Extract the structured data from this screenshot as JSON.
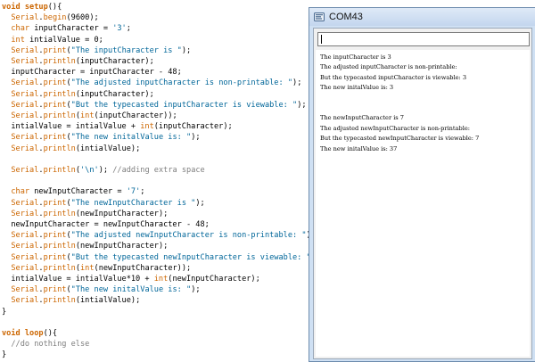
{
  "editor": {
    "lines": [
      [
        {
          "t": "void ",
          "c": "kw"
        },
        {
          "t": "setup",
          "c": "kw"
        },
        {
          "t": "(){",
          "c": ""
        }
      ],
      [
        {
          "t": "  ",
          "c": ""
        },
        {
          "t": "Serial",
          "c": "fn"
        },
        {
          "t": ".",
          "c": ""
        },
        {
          "t": "begin",
          "c": "fn"
        },
        {
          "t": "(9600);",
          "c": ""
        }
      ],
      [
        {
          "t": "  ",
          "c": ""
        },
        {
          "t": "char",
          "c": "ty"
        },
        {
          "t": " inputCharacter = ",
          "c": ""
        },
        {
          "t": "'3'",
          "c": "str"
        },
        {
          "t": ";",
          "c": ""
        }
      ],
      [
        {
          "t": "  ",
          "c": ""
        },
        {
          "t": "int",
          "c": "ty"
        },
        {
          "t": " intialValue = 0;",
          "c": ""
        }
      ],
      [
        {
          "t": "  ",
          "c": ""
        },
        {
          "t": "Serial",
          "c": "fn"
        },
        {
          "t": ".",
          "c": ""
        },
        {
          "t": "print",
          "c": "fn"
        },
        {
          "t": "(",
          "c": ""
        },
        {
          "t": "\"The inputCharacter is \"",
          "c": "str"
        },
        {
          "t": ");",
          "c": ""
        }
      ],
      [
        {
          "t": "  ",
          "c": ""
        },
        {
          "t": "Serial",
          "c": "fn"
        },
        {
          "t": ".",
          "c": ""
        },
        {
          "t": "println",
          "c": "fn"
        },
        {
          "t": "(inputCharacter);",
          "c": ""
        }
      ],
      [
        {
          "t": "  inputCharacter = inputCharacter - 48;",
          "c": ""
        }
      ],
      [
        {
          "t": "  ",
          "c": ""
        },
        {
          "t": "Serial",
          "c": "fn"
        },
        {
          "t": ".",
          "c": ""
        },
        {
          "t": "print",
          "c": "fn"
        },
        {
          "t": "(",
          "c": ""
        },
        {
          "t": "\"The adjusted inputCharacter is non-printable: \"",
          "c": "str"
        },
        {
          "t": ");",
          "c": ""
        }
      ],
      [
        {
          "t": "  ",
          "c": ""
        },
        {
          "t": "Serial",
          "c": "fn"
        },
        {
          "t": ".",
          "c": ""
        },
        {
          "t": "println",
          "c": "fn"
        },
        {
          "t": "(inputCharacter);",
          "c": ""
        }
      ],
      [
        {
          "t": "  ",
          "c": ""
        },
        {
          "t": "Serial",
          "c": "fn"
        },
        {
          "t": ".",
          "c": ""
        },
        {
          "t": "print",
          "c": "fn"
        },
        {
          "t": "(",
          "c": ""
        },
        {
          "t": "\"But the typecasted inputCharacter is viewable: \"",
          "c": "str"
        },
        {
          "t": ");",
          "c": ""
        }
      ],
      [
        {
          "t": "  ",
          "c": ""
        },
        {
          "t": "Serial",
          "c": "fn"
        },
        {
          "t": ".",
          "c": ""
        },
        {
          "t": "println",
          "c": "fn"
        },
        {
          "t": "(",
          "c": ""
        },
        {
          "t": "int",
          "c": "ty"
        },
        {
          "t": "(inputCharacter));",
          "c": ""
        }
      ],
      [
        {
          "t": "  intialValue = intialValue + ",
          "c": ""
        },
        {
          "t": "int",
          "c": "ty"
        },
        {
          "t": "(inputCharacter);",
          "c": ""
        }
      ],
      [
        {
          "t": "  ",
          "c": ""
        },
        {
          "t": "Serial",
          "c": "fn"
        },
        {
          "t": ".",
          "c": ""
        },
        {
          "t": "print",
          "c": "fn"
        },
        {
          "t": "(",
          "c": ""
        },
        {
          "t": "\"The new initalValue is: \"",
          "c": "str"
        },
        {
          "t": ");",
          "c": ""
        }
      ],
      [
        {
          "t": "  ",
          "c": ""
        },
        {
          "t": "Serial",
          "c": "fn"
        },
        {
          "t": ".",
          "c": ""
        },
        {
          "t": "println",
          "c": "fn"
        },
        {
          "t": "(intialValue);",
          "c": ""
        }
      ],
      [],
      [
        {
          "t": "  ",
          "c": ""
        },
        {
          "t": "Serial",
          "c": "fn"
        },
        {
          "t": ".",
          "c": ""
        },
        {
          "t": "println",
          "c": "fn"
        },
        {
          "t": "(",
          "c": ""
        },
        {
          "t": "'\\n'",
          "c": "str"
        },
        {
          "t": "); ",
          "c": ""
        },
        {
          "t": "//adding extra space",
          "c": "com"
        }
      ],
      [],
      [
        {
          "t": "  ",
          "c": ""
        },
        {
          "t": "char",
          "c": "ty"
        },
        {
          "t": " newInputCharacter = ",
          "c": ""
        },
        {
          "t": "'7'",
          "c": "str"
        },
        {
          "t": ";",
          "c": ""
        }
      ],
      [
        {
          "t": "  ",
          "c": ""
        },
        {
          "t": "Serial",
          "c": "fn"
        },
        {
          "t": ".",
          "c": ""
        },
        {
          "t": "print",
          "c": "fn"
        },
        {
          "t": "(",
          "c": ""
        },
        {
          "t": "\"The newInputCharacter is \"",
          "c": "str"
        },
        {
          "t": ");",
          "c": ""
        }
      ],
      [
        {
          "t": "  ",
          "c": ""
        },
        {
          "t": "Serial",
          "c": "fn"
        },
        {
          "t": ".",
          "c": ""
        },
        {
          "t": "println",
          "c": "fn"
        },
        {
          "t": "(newInputCharacter);",
          "c": ""
        }
      ],
      [
        {
          "t": "  newInputCharacter = newInputCharacter - 48;",
          "c": ""
        }
      ],
      [
        {
          "t": "  ",
          "c": ""
        },
        {
          "t": "Serial",
          "c": "fn"
        },
        {
          "t": ".",
          "c": ""
        },
        {
          "t": "print",
          "c": "fn"
        },
        {
          "t": "(",
          "c": ""
        },
        {
          "t": "\"The adjusted newInputCharacter is non-printable: \"",
          "c": "str"
        },
        {
          "t": ");",
          "c": ""
        }
      ],
      [
        {
          "t": "  ",
          "c": ""
        },
        {
          "t": "Serial",
          "c": "fn"
        },
        {
          "t": ".",
          "c": ""
        },
        {
          "t": "println",
          "c": "fn"
        },
        {
          "t": "(newInputCharacter);",
          "c": ""
        }
      ],
      [
        {
          "t": "  ",
          "c": ""
        },
        {
          "t": "Serial",
          "c": "fn"
        },
        {
          "t": ".",
          "c": ""
        },
        {
          "t": "print",
          "c": "fn"
        },
        {
          "t": "(",
          "c": ""
        },
        {
          "t": "\"But the typecasted newInputCharacter is viewable: \"",
          "c": "str"
        },
        {
          "t": ");",
          "c": ""
        }
      ],
      [
        {
          "t": "  ",
          "c": ""
        },
        {
          "t": "Serial",
          "c": "fn"
        },
        {
          "t": ".",
          "c": ""
        },
        {
          "t": "println",
          "c": "fn"
        },
        {
          "t": "(",
          "c": ""
        },
        {
          "t": "int",
          "c": "ty"
        },
        {
          "t": "(newInputCharacter));",
          "c": ""
        }
      ],
      [
        {
          "t": "  intialValue = intialValue*10 + ",
          "c": ""
        },
        {
          "t": "int",
          "c": "ty"
        },
        {
          "t": "(newInputCharacter);",
          "c": ""
        }
      ],
      [
        {
          "t": "  ",
          "c": ""
        },
        {
          "t": "Serial",
          "c": "fn"
        },
        {
          "t": ".",
          "c": ""
        },
        {
          "t": "print",
          "c": "fn"
        },
        {
          "t": "(",
          "c": ""
        },
        {
          "t": "\"The new initalValue is: \"",
          "c": "str"
        },
        {
          "t": ");",
          "c": ""
        }
      ],
      [
        {
          "t": "  ",
          "c": ""
        },
        {
          "t": "Serial",
          "c": "fn"
        },
        {
          "t": ".",
          "c": ""
        },
        {
          "t": "println",
          "c": "fn"
        },
        {
          "t": "(intialValue);",
          "c": ""
        }
      ],
      [
        {
          "t": "}",
          "c": ""
        }
      ],
      [],
      [
        {
          "t": "void ",
          "c": "kw"
        },
        {
          "t": "loop",
          "c": "kw"
        },
        {
          "t": "(){",
          "c": ""
        }
      ],
      [
        {
          "t": "  ",
          "c": ""
        },
        {
          "t": "//do nothing else",
          "c": "com"
        }
      ],
      [
        {
          "t": "}",
          "c": ""
        }
      ]
    ]
  },
  "serial_monitor": {
    "title": "COM43",
    "icon": "serial-monitor-icon",
    "send_value": "",
    "output_lines": [
      "The inputCharacter is 3",
      "The adjusted inputCharacter is non-printable:",
      "But the typecasted inputCharacter is viewable: 3",
      "The new initalValue is: 3",
      "",
      "",
      "The newInputCharacter is 7",
      "The adjusted newInputCharacter is non-printable:",
      "But the typecasted newInputCharacter is viewable: 7",
      "The new initalValue is: 37"
    ]
  },
  "colors": {
    "keyword": "#cc6600",
    "string": "#006699",
    "comment": "#7e7e7e",
    "titlebar": "#c3d6ee"
  }
}
